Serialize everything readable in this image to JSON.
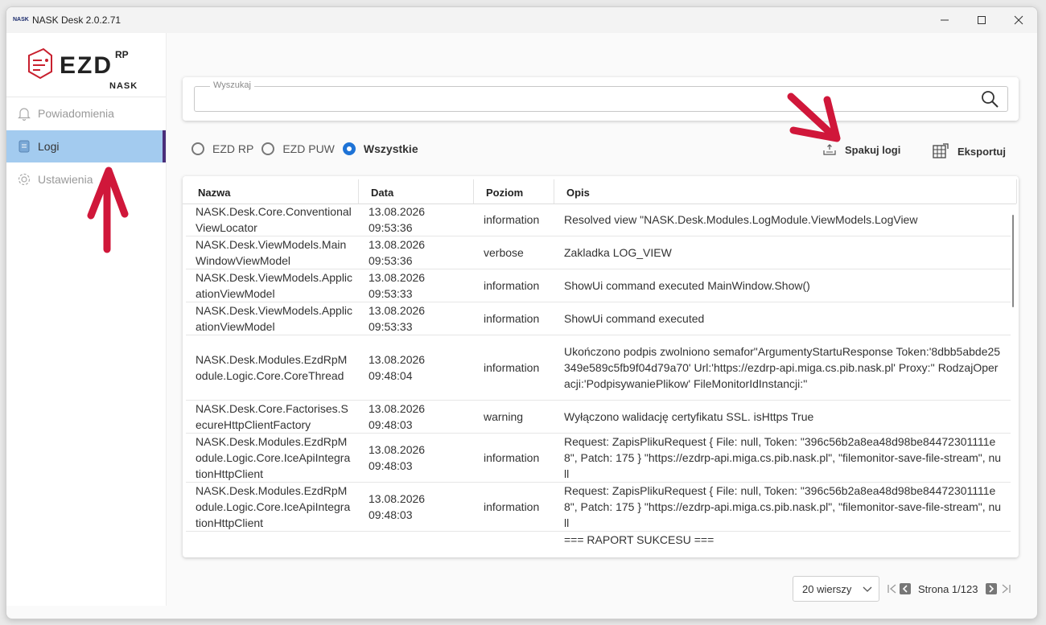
{
  "window": {
    "title": "NASK Desk 2.0.2.71",
    "app_icon": "NASK"
  },
  "brand": {
    "logo_main": "EZD",
    "logo_sup": "RP",
    "logo_sub": "NASK"
  },
  "sidebar": {
    "items": [
      {
        "label": "Powiadomienia",
        "icon": "bell-icon",
        "active": false
      },
      {
        "label": "Logi",
        "icon": "log-icon",
        "active": true
      },
      {
        "label": "Ustawienia",
        "icon": "gear-icon",
        "active": false
      }
    ]
  },
  "search": {
    "label": "Wyszukaj",
    "value": "",
    "placeholder": ""
  },
  "filters": {
    "options": [
      {
        "label": "EZD RP",
        "checked": false
      },
      {
        "label": "EZD PUW",
        "checked": false
      },
      {
        "label": "Wszystkie",
        "checked": true
      }
    ]
  },
  "actions": {
    "pack_logs": "Spakuj logi",
    "export": "Eksportuj"
  },
  "table": {
    "columns": [
      "Nazwa",
      "Data",
      "Poziom",
      "Opis"
    ],
    "rows": [
      {
        "name": "NASK.Desk.Core.ConventionalViewLocator",
        "date": "13.08.2026 09:53:36",
        "level": "information",
        "desc": "Resolved view \"NASK.Desk.Modules.LogModule.ViewModels.LogView"
      },
      {
        "name": "NASK.Desk.ViewModels.MainWindowViewModel",
        "date": "13.08.2026 09:53:36",
        "level": "verbose",
        "desc": "Zakladka LOG_VIEW"
      },
      {
        "name": "NASK.Desk.ViewModels.ApplicationViewModel",
        "date": "13.08.2026 09:53:33",
        "level": "information",
        "desc": "ShowUi command executed MainWindow.Show()"
      },
      {
        "name": "NASK.Desk.ViewModels.ApplicationViewModel",
        "date": "13.08.2026 09:53:33",
        "level": "information",
        "desc": "ShowUi command executed"
      },
      {
        "name": "NASK.Desk.Modules.EzdRpModule.Logic.Core.CoreThread",
        "date": "13.08.2026 09:48:04",
        "level": "information",
        "desc": "Ukończono podpis zwolniono semafor\"ArgumentyStartuResponse Token:'8dbb5abde25349e589c5fb9f04d79a70' Url:'https://ezdrp-api.miga.cs.pib.nask.pl' Proxy:'' RodzajOperacji:'PodpisywaniePlikow' FileMonitorIdInstancji:''"
      },
      {
        "name": "NASK.Desk.Core.Factorises.SecureHttpClientFactory",
        "date": "13.08.2026 09:48:03",
        "level": "warning",
        "desc": "Wyłączono walidację certyfikatu SSL. isHttps True"
      },
      {
        "name": "NASK.Desk.Modules.EzdRpModule.Logic.Core.IceApiIntegrationHttpClient",
        "date": "13.08.2026 09:48:03",
        "level": "information",
        "desc": "Request: ZapisPlikuRequest { File: null, Token: \"396c56b2a8ea48d98be84472301111e8\", Patch: 175 } \"https://ezdrp-api.miga.cs.pib.nask.pl\", \"filemonitor-save-file-stream\", null"
      },
      {
        "name": "NASK.Desk.Modules.EzdRpModule.Logic.Core.IceApiIntegrationHttpClient",
        "date": "13.08.2026 09:48:03",
        "level": "information",
        "desc": "Request: ZapisPlikuRequest { File: null, Token: \"396c56b2a8ea48d98be84472301111e8\", Patch: 175 } \"https://ezdrp-api.miga.cs.pib.nask.pl\", \"filemonitor-save-file-stream\", null"
      },
      {
        "name": "",
        "date": "",
        "level": "",
        "desc": "=== RAPORT SUKCESU ==="
      }
    ]
  },
  "pagination": {
    "rows_per_page": "20 wierszy",
    "page_label": "Strona 1/123"
  },
  "colors": {
    "accent": "#1e73d6",
    "active_nav": "#a3cbef",
    "active_bar": "#4a2e7a",
    "brand_red": "#c8202e"
  }
}
